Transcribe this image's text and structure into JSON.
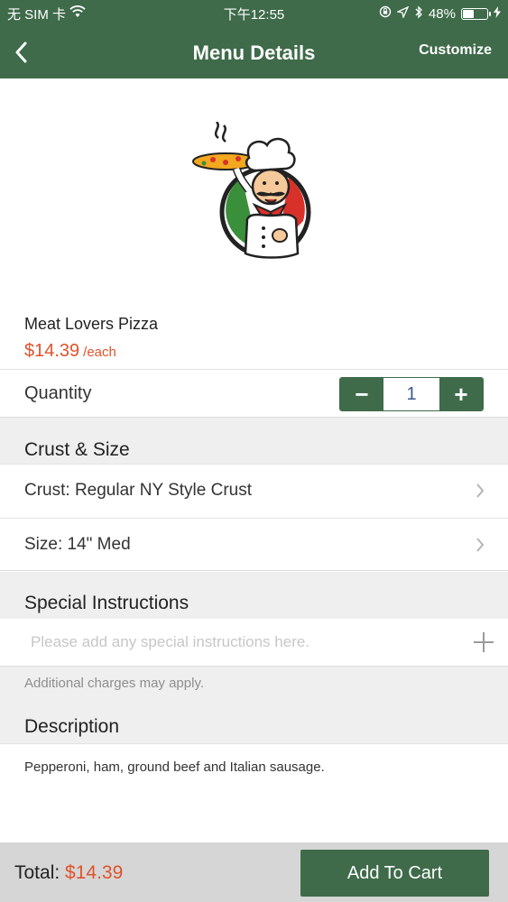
{
  "status_bar": {
    "carrier": "无 SIM 卡",
    "time": "下午12:55",
    "battery_percent": "48%",
    "battery_level": 0.48
  },
  "nav": {
    "title": "Menu Details",
    "customize_label": "Customize",
    "back_icon": "chevron-left-icon"
  },
  "item": {
    "name": "Meat Lovers Pizza",
    "price": "$14.39",
    "price_unit": "/each"
  },
  "quantity": {
    "label": "Quantity",
    "value": "1",
    "decrement": "−",
    "increment": "+"
  },
  "crust_size": {
    "header": "Crust & Size",
    "crust_option": "Crust: Regular NY Style Crust",
    "size_option": "Size: 14\" Med"
  },
  "special_instructions": {
    "header": "Special Instructions",
    "placeholder": "Please add any special instructions here.",
    "note": "Additional charges may apply."
  },
  "description": {
    "header": "Description",
    "text": "Pepperoni, ham, ground beef and Italian sausage."
  },
  "footer": {
    "total_label": "Total:",
    "total_amount": "$14.39",
    "add_to_cart_label": "Add To Cart"
  },
  "colors": {
    "brand_green": "#3f6b4a",
    "price_orange": "#e0522b"
  }
}
